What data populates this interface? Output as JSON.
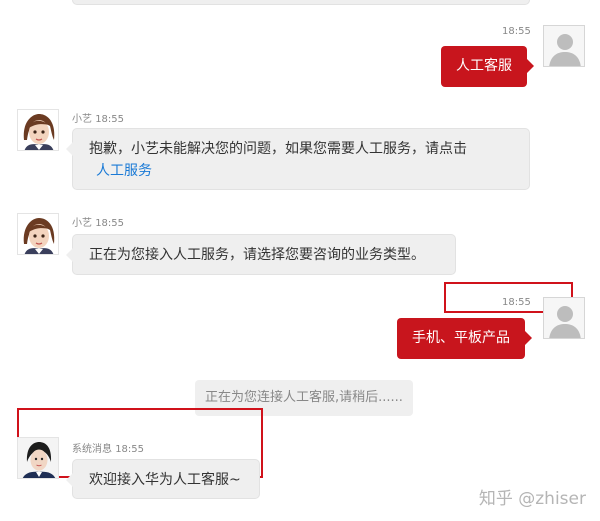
{
  "messages": {
    "m1": {
      "time": "18:55",
      "text": "人工客服"
    },
    "m2": {
      "sender": "小艺",
      "time": "18:55",
      "text": "抱歉，小艺未能解决您的问题，如果您需要人工服务，请点击",
      "link": "人工服务"
    },
    "m3": {
      "sender": "小艺",
      "time": "18:55",
      "text": "正在为您接入人工服务，请选择您要咨询的业务类型。"
    },
    "m4": {
      "time": "18:55",
      "text": "手机、平板产品"
    },
    "status": {
      "text": "正在为您连接人工客服,请稍后......"
    },
    "m5": {
      "sender": "系统消息",
      "time": "18:55",
      "text": "欢迎接入华为人工客服~"
    }
  },
  "watermark": "知乎 @zhiser",
  "colors": {
    "user_bubble": "#c8151d",
    "bot_bubble": "#efefef",
    "link": "#1a7ad6",
    "highlight_box": "#d0121b"
  }
}
